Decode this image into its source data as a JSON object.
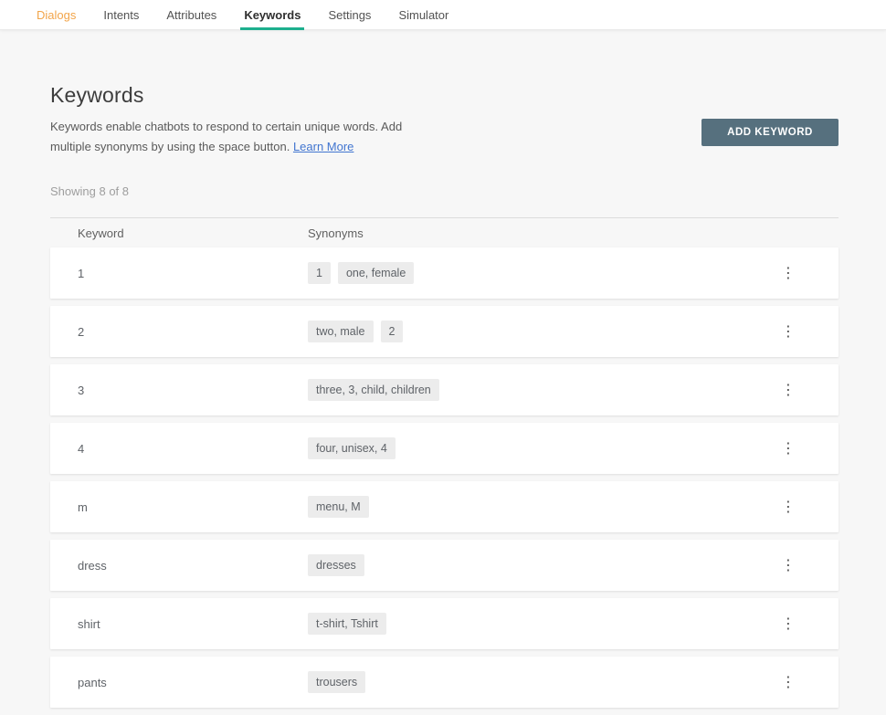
{
  "tabs": {
    "items": [
      {
        "label": "Dialogs"
      },
      {
        "label": "Intents"
      },
      {
        "label": "Attributes"
      },
      {
        "label": "Keywords"
      },
      {
        "label": "Settings"
      },
      {
        "label": "Simulator"
      }
    ],
    "active_tab": "Keywords"
  },
  "page": {
    "title": "Keywords",
    "description": "Keywords enable chatbots to respond to certain unique words. Add multiple synonyms by using the space button.",
    "learn_more_label": "Learn More",
    "add_button_label": "ADD KEYWORD",
    "showing_text": "Showing 8 of 8"
  },
  "table": {
    "headers": {
      "keyword": "Keyword",
      "synonyms": "Synonyms"
    },
    "rows": [
      {
        "keyword": "1",
        "synonyms": [
          "1",
          "one, female"
        ]
      },
      {
        "keyword": "2",
        "synonyms": [
          "two, male",
          "2"
        ]
      },
      {
        "keyword": "3",
        "synonyms": [
          "three, 3, child, children"
        ]
      },
      {
        "keyword": "4",
        "synonyms": [
          "four, unisex, 4"
        ]
      },
      {
        "keyword": "m",
        "synonyms": [
          "menu, M"
        ]
      },
      {
        "keyword": "dress",
        "synonyms": [
          "dresses"
        ]
      },
      {
        "keyword": "shirt",
        "synonyms": [
          "t-shirt, Tshirt"
        ]
      },
      {
        "keyword": "pants",
        "synonyms": [
          "trousers"
        ]
      }
    ]
  },
  "icons": {
    "row_menu": "kebab-menu-icon",
    "row_menu_glyph": "⋮"
  },
  "colors": {
    "accent_orange": "#F2A449",
    "active_tab_underline": "#1DAF8E",
    "add_button_bg": "#56707E",
    "link_blue": "#4175D0",
    "chip_bg": "#ECECEC",
    "page_bg": "#F7F7F7"
  }
}
